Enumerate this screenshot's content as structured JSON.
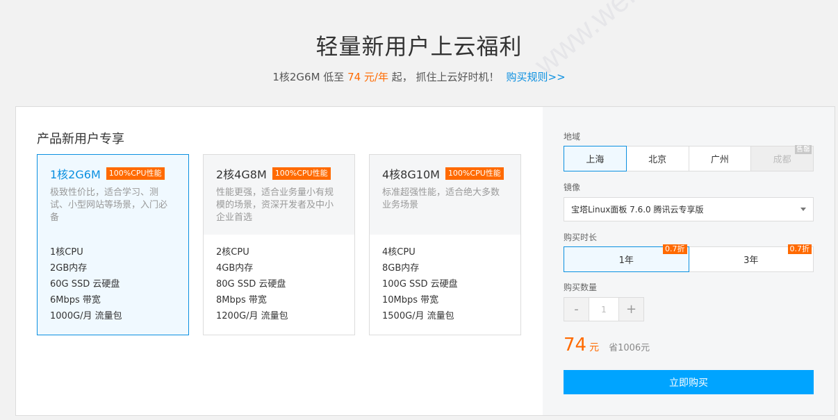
{
  "hero": {
    "title": "轻量新用户上云福利",
    "sub_prefix": "1核2G6M 低至 ",
    "sub_price": "74 元/年",
    "sub_suffix": " 起， 抓住上云好时机！",
    "rules_link": "购买规则>>"
  },
  "section_title": "产品新用户专享",
  "cards": [
    {
      "name": "1核2G6M",
      "badge": "100%CPU性能",
      "desc": "极致性价比，适合学习、测试、小型网站等场景，入门必备",
      "specs": [
        "1核CPU",
        "2GB内存",
        "60G SSD 云硬盘",
        "6Mbps 带宽",
        "1000G/月 流量包"
      ]
    },
    {
      "name": "2核4G8M",
      "badge": "100%CPU性能",
      "desc": "性能更强，适合业务量小有规模的场景，资深开发者及中小企业首选",
      "specs": [
        "2核CPU",
        "4GB内存",
        "80G SSD 云硬盘",
        "8Mbps 带宽",
        "1200G/月 流量包"
      ]
    },
    {
      "name": "4核8G10M",
      "badge": "100%CPU性能",
      "desc": "标准超强性能，适合绝大多数业务场景",
      "specs": [
        "4核CPU",
        "8GB内存",
        "100G SSD 云硬盘",
        "10Mbps 带宽",
        "1500G/月 流量包"
      ]
    }
  ],
  "order": {
    "region_label": "地域",
    "regions": [
      "上海",
      "北京",
      "广州",
      "成都"
    ],
    "region_tag": "售罄",
    "image_label": "镜像",
    "image_value": "宝塔Linux面板 7.6.0 腾讯云专享版",
    "duration_label": "购买时长",
    "durations": [
      "1年",
      "3年"
    ],
    "discount": "0.7折",
    "quantity_label": "购买数量",
    "minus": "-",
    "quantity": "1",
    "plus": "+",
    "price": "74",
    "price_unit": "元",
    "save_text": "省1006元",
    "buy_label": "立即购买"
  },
  "watermark": "www.weidc.com",
  "colors": {
    "accent": "#0a8fe0",
    "price": "#ff6a00",
    "buy": "#00a4ff"
  }
}
